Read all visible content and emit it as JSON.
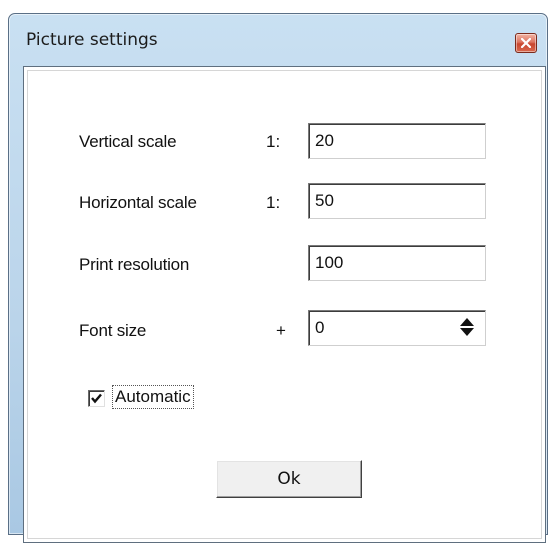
{
  "window": {
    "title": "Picture settings"
  },
  "form": {
    "vertical_scale": {
      "label": "Vertical scale",
      "prefix": "1:",
      "value": "20"
    },
    "horizontal_scale": {
      "label": "Horizontal scale",
      "prefix": "1:",
      "value": "50"
    },
    "print_resolution": {
      "label": "Print resolution",
      "value": "100"
    },
    "font_size": {
      "label": "Font size",
      "prefix": "+",
      "value": "0"
    },
    "automatic": {
      "label": "Automatic",
      "checked": true
    }
  },
  "buttons": {
    "ok": "Ok"
  },
  "icons": {
    "close": "close-icon",
    "spin": "spin-updown-icon",
    "check": "checkmark-icon"
  },
  "colors": {
    "titlebar": "#bad4ea",
    "close_button": "#c8452e",
    "client_background": "#ffffff"
  }
}
